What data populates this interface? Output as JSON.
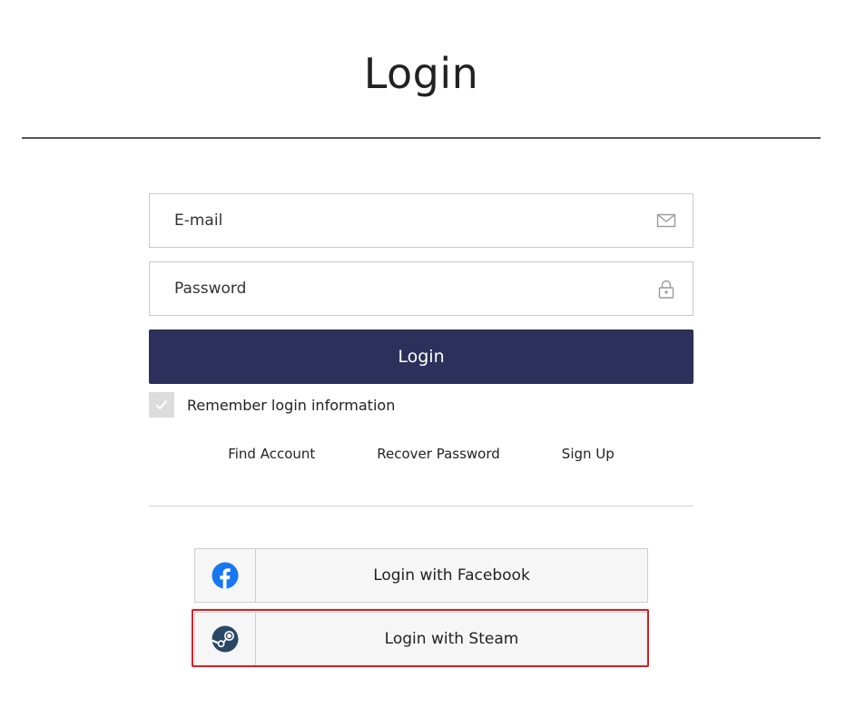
{
  "page": {
    "title": "Login"
  },
  "form": {
    "email_placeholder": "E-mail",
    "email_value": "",
    "password_placeholder": "Password",
    "password_value": "",
    "login_button_label": "Login",
    "remember_label": "Remember login information",
    "remember_checked": true
  },
  "links": {
    "find_account": "Find Account",
    "recover_password": "Recover Password",
    "sign_up": "Sign Up"
  },
  "social": {
    "facebook_label": "Login with Facebook",
    "steam_label": "Login with Steam"
  },
  "icons": {
    "email": "envelope-icon",
    "password": "lock-icon",
    "remember": "checkmark-icon",
    "facebook": "facebook-logo-icon",
    "steam": "steam-logo-icon"
  },
  "colors": {
    "login_button_bg": "#2c305a",
    "facebook_blue": "#1877f2",
    "steam_blue": "#2a4766",
    "highlight_red": "#e01818"
  }
}
